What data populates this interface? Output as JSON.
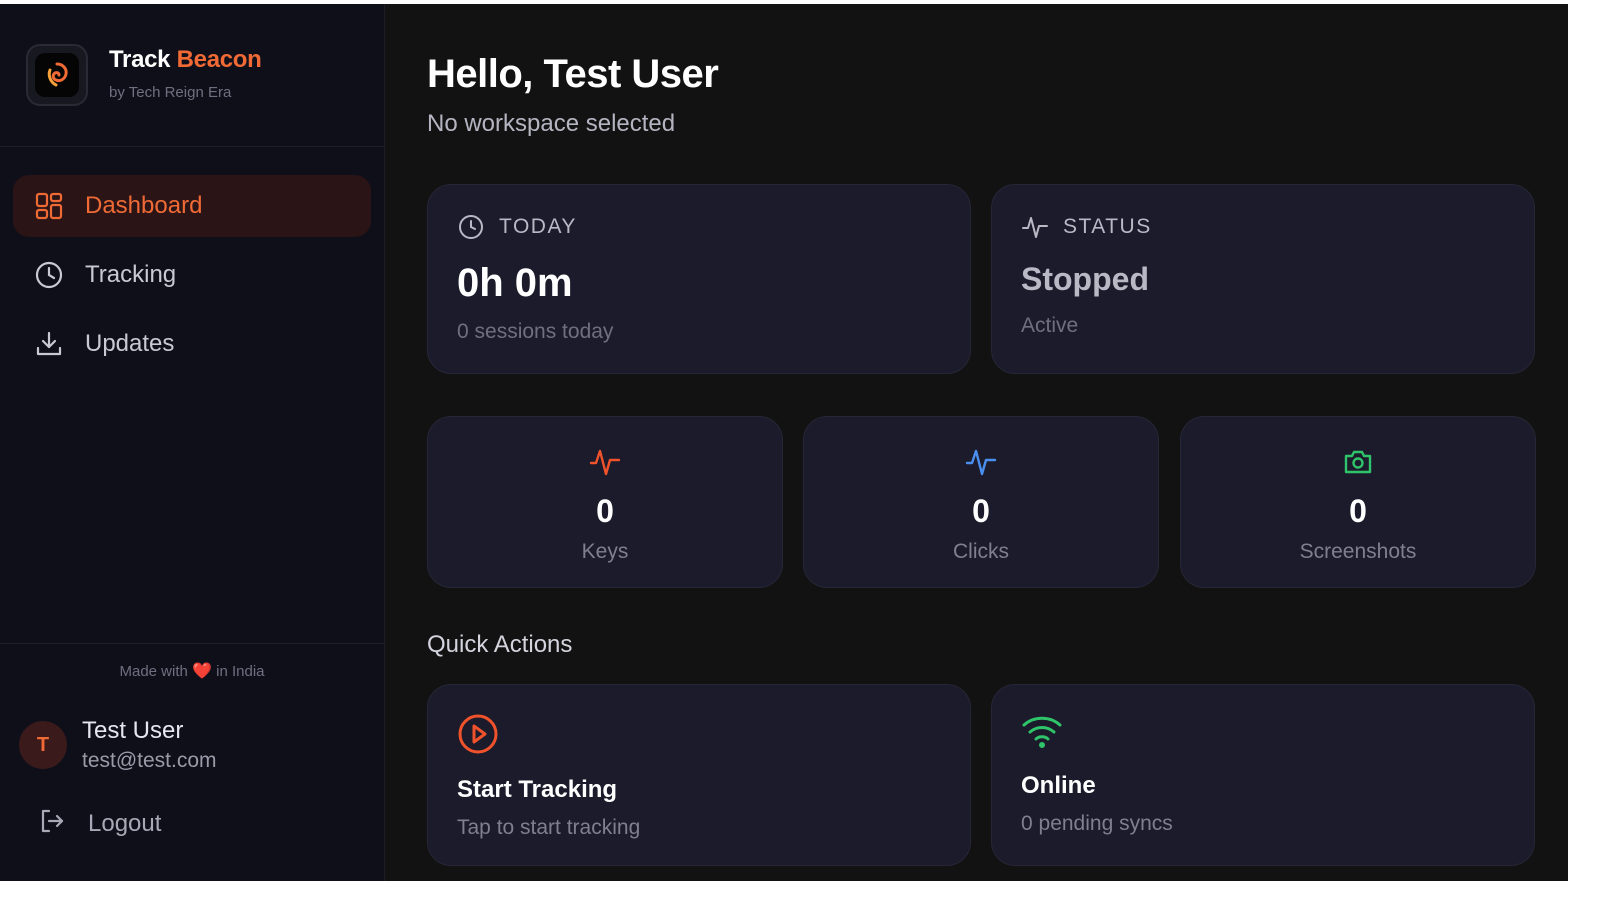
{
  "brand": {
    "title_part1": "Track",
    "title_part2": "Beacon",
    "subtitle": "by Tech Reign Era",
    "accent_color": "#f06a35"
  },
  "nav": {
    "items": [
      {
        "label": "Dashboard",
        "icon": "dashboard-grid-icon",
        "active": true
      },
      {
        "label": "Tracking",
        "icon": "clock-icon",
        "active": false
      },
      {
        "label": "Updates",
        "icon": "download-icon",
        "active": false
      }
    ]
  },
  "footer": {
    "made_with_prefix": "Made with",
    "heart": "❤️",
    "made_with_suffix": "in India"
  },
  "user": {
    "initial": "T",
    "name": "Test User",
    "email": "test@test.com"
  },
  "logout": {
    "label": "Logout"
  },
  "header": {
    "greeting": "Hello, Test User",
    "workspace": "No workspace selected"
  },
  "today": {
    "label": "TODAY",
    "value": "0h 0m",
    "sub": "0 sessions today"
  },
  "status": {
    "label": "STATUS",
    "value": "Stopped",
    "sub": "Active"
  },
  "stats": {
    "keys": {
      "value": "0",
      "label": "Keys",
      "color": "#f0532b"
    },
    "clicks": {
      "value": "0",
      "label": "Clicks",
      "color": "#4a8ff0"
    },
    "screenshots": {
      "value": "0",
      "label": "Screenshots",
      "color": "#2fc46a"
    }
  },
  "quick_actions": {
    "title": "Quick Actions",
    "start": {
      "title": "Start Tracking",
      "sub": "Tap to start tracking",
      "color": "#f0532b"
    },
    "online": {
      "title": "Online",
      "sub": "0 pending syncs",
      "color": "#2fc46a"
    }
  }
}
